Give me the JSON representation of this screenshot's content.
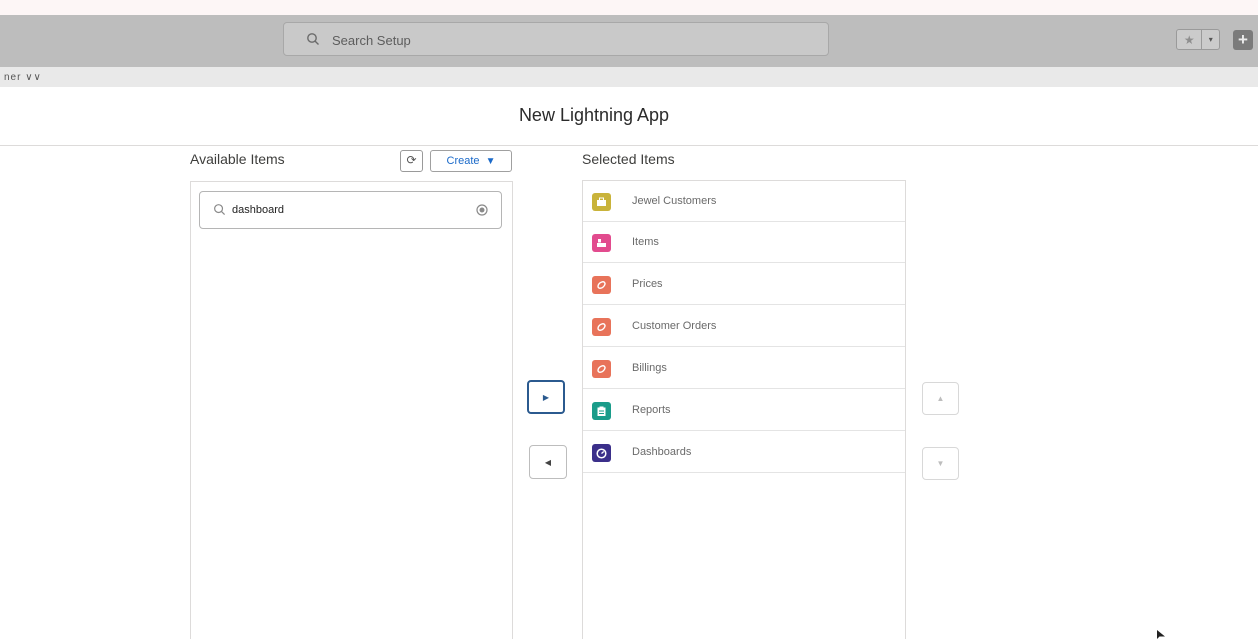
{
  "header": {
    "search_placeholder": "Search Setup",
    "favorites_star": "★",
    "favorites_dropdown": "▾",
    "add_glyph": "+"
  },
  "subbar": {
    "crumb": "ner ∨∨"
  },
  "modal": {
    "title": "New Lightning App"
  },
  "available": {
    "label": "Available Items",
    "refresh_glyph": "⟳",
    "create_label": "Create",
    "create_caret": "▼",
    "filter_value": "dashboard"
  },
  "selected": {
    "label": "Selected Items",
    "items": [
      {
        "label": "Jewel Customers",
        "color": "#c9b33a",
        "icon": "case-icon"
      },
      {
        "label": "Items",
        "color": "#e24b8e",
        "icon": "product-icon"
      },
      {
        "label": "Prices",
        "color": "#e8735a",
        "icon": "tag-icon"
      },
      {
        "label": "Customer Orders",
        "color": "#e8735a",
        "icon": "tag-icon"
      },
      {
        "label": "Billings",
        "color": "#e8735a",
        "icon": "tag-icon"
      },
      {
        "label": "Reports",
        "color": "#1a9c8a",
        "icon": "report-icon"
      },
      {
        "label": "Dashboards",
        "color": "#3b2f8a",
        "icon": "dashboard-icon"
      }
    ]
  },
  "controls": {
    "move_right": "▶",
    "move_left": "◀",
    "move_up": "▲",
    "move_down": "▼"
  }
}
